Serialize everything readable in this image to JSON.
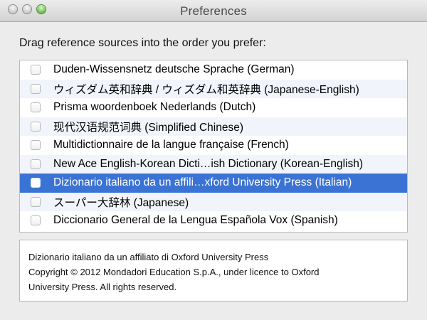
{
  "window": {
    "title": "Preferences"
  },
  "main": {
    "instruction": "Drag reference sources into the order you prefer:",
    "sources": [
      {
        "label": "Duden-Wissensnetz deutsche Sprache (German)",
        "checked": false
      },
      {
        "label": "ウィズダム英和辞典 / ウィズダム和英辞典 (Japanese-English)",
        "checked": false
      },
      {
        "label": "Prisma woordenboek Nederlands (Dutch)",
        "checked": false
      },
      {
        "label": "现代汉语规范词典 (Simplified Chinese)",
        "checked": false
      },
      {
        "label": "Multidictionnaire de la langue française (French)",
        "checked": false
      },
      {
        "label": "New Ace English-Korean Dicti…ish Dictionary (Korean-English)",
        "checked": false
      },
      {
        "label": "Dizionario italiano da un affili…xford University Press (Italian)",
        "checked": false,
        "selected": true
      },
      {
        "label": "スーパー大辞林 (Japanese)",
        "checked": false
      },
      {
        "label": "Diccionario General de la Lengua Española Vox (Spanish)",
        "checked": false
      }
    ],
    "details": [
      "Dizionario italiano da un affiliato di Oxford University Press",
      "Copyright © 2012 Mondadori Education S.p.A., under licence to Oxford",
      "University Press. All rights reserved."
    ]
  },
  "colors": {
    "selected_row": "#3b73d4",
    "alternate_row": "#f1f4fa",
    "window_background": "#ececec"
  }
}
